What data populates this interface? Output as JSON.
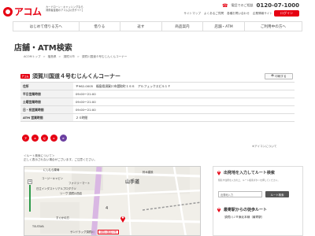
{
  "header": {
    "logo_text": "アコム",
    "tagline_lines": [
      "カードローン・キャッシングなら",
      "消費者金融のアコム[公式サイト]"
    ],
    "phone_label": "電話でのご相談",
    "phone_number": "0120-07-1000",
    "util_links": [
      "サイトマップ",
      "よくあるご質問",
      "各種お問い合わせ",
      "企業情報サイト"
    ],
    "login_label": "ログイン"
  },
  "gnav": [
    "はじめて借りる方へ",
    "借りる",
    "返す",
    "商品案内",
    "店舗・ATM",
    "ご利用中の方へ"
  ],
  "page_title": "店舗・ATM検索",
  "breadcrumb": [
    "ACOMトップ",
    "福島県",
    "須賀川市",
    "須賀川国道４号むじんくんコーナー"
  ],
  "store": {
    "badge": "アコム",
    "name": "須賀川国道４号むじんくんコーナー",
    "print_label": "印刷する",
    "info": [
      {
        "k": "住所",
        "v": "〒962-0005　福島県須賀川市舘取町１６６　アルフェックスビル１Ｆ"
      },
      {
        "k": "平日営業時間",
        "v": "09:00～21:00"
      },
      {
        "k": "土曜営業時間",
        "v": "09:00～21:00"
      },
      {
        "k": "日・祝営業時間",
        "v": "09:00～21:00"
      },
      {
        "k": "ATM 営業時間",
        "v": "２４時間"
      }
    ],
    "service_icons": [
      {
        "name": "acom-service-icon",
        "color": "#e60012",
        "text": "ア"
      },
      {
        "name": "acom-atm-icon",
        "color": "#e60012",
        "text": "A"
      },
      {
        "name": "mujinkun-icon",
        "color": "#e60012",
        "text": "む"
      },
      {
        "name": "card-icon",
        "color": "#e60012",
        "text": "C"
      },
      {
        "name": "parking-icon",
        "color": "#6b3fa0",
        "text": "P"
      }
    ],
    "icon_legend": "※アイコンについて"
  },
  "route_note": [
    "＜ルート検索について＞",
    "正しく表示されない場合がございます。ご注意ください。"
  ],
  "map": {
    "labels": {
      "nishimura": "にしむら薬局",
      "cozy": "コージーキャビン",
      "family": "ファミリーマート",
      "hitachi": "日立インダストリアルプロダクツ",
      "rikyu": "リーヴ 須賀川西店",
      "sugu": "すぐかの方",
      "tsutaya": "TSUTAYA",
      "sundrug": "サンドラッグ須賀川",
      "yamanote": "山手道",
      "suzuki": "鈴木建設",
      "route4": "4",
      "store_tag": "須賀川国道４号"
    },
    "zoom_in": "+"
  },
  "route_panel": {
    "title": "出発地を入力してルート検索",
    "desc": "駅名や住所を入力の上、ルート検索ボタンを押してください。",
    "input_placeholder": "出発地入力",
    "button_label": "ルート検索",
    "title2": "最寄駅からの徒歩ルート",
    "station_line": "須賀川ＪＲ東北本線（最寄駅）"
  }
}
